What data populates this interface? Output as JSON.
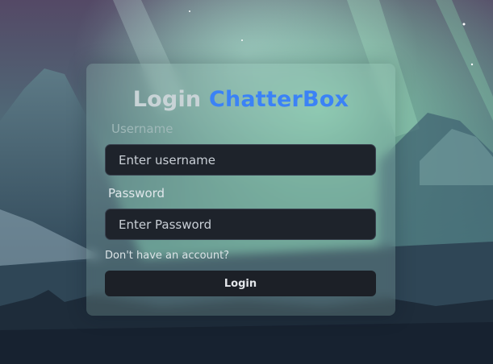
{
  "background": {
    "description_icon": "aurora-mountain-landscape",
    "colors": {
      "sky_top": "#5a4d6e",
      "aurora": "#7fc9a8",
      "mountains": "#3d5568",
      "forest": "#1c2a38"
    }
  },
  "login_card": {
    "title_prefix": "Login",
    "title_brand": "ChatterBox",
    "brand_color": "#3b82f6",
    "username": {
      "label": "Username",
      "placeholder": "Enter username",
      "value": ""
    },
    "password": {
      "label": "Password",
      "placeholder": "Enter Password",
      "value": ""
    },
    "signup_link": "Don't have an account?",
    "submit_label": "Login"
  }
}
